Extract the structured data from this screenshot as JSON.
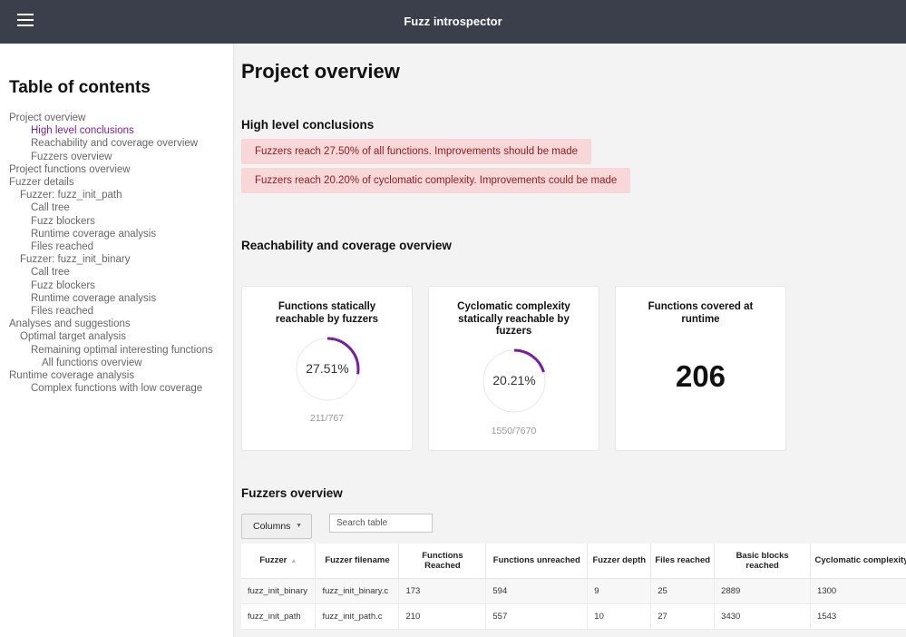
{
  "header": {
    "title": "Fuzz introspector",
    "menu_icon": "hamburger-menu-icon"
  },
  "sidebar": {
    "title": "Table of contents",
    "items": [
      {
        "label": "Project overview",
        "level": 1,
        "active": false
      },
      {
        "label": "High level conclusions",
        "level": 3,
        "active": true
      },
      {
        "label": "Reachability and coverage overview",
        "level": 3,
        "active": false
      },
      {
        "label": "Fuzzers overview",
        "level": 3,
        "active": false
      },
      {
        "label": "Project functions overview",
        "level": 1,
        "active": false
      },
      {
        "label": "Fuzzer details",
        "level": 1,
        "active": false
      },
      {
        "label": "Fuzzer: fuzz_init_path",
        "level": 2,
        "active": false
      },
      {
        "label": "Call tree",
        "level": 3,
        "active": false
      },
      {
        "label": "Fuzz blockers",
        "level": 3,
        "active": false
      },
      {
        "label": "Runtime coverage analysis",
        "level": 3,
        "active": false
      },
      {
        "label": "Files reached",
        "level": 3,
        "active": false
      },
      {
        "label": "Fuzzer: fuzz_init_binary",
        "level": 2,
        "active": false
      },
      {
        "label": "Call tree",
        "level": 3,
        "active": false
      },
      {
        "label": "Fuzz blockers",
        "level": 3,
        "active": false
      },
      {
        "label": "Runtime coverage analysis",
        "level": 3,
        "active": false
      },
      {
        "label": "Files reached",
        "level": 3,
        "active": false
      },
      {
        "label": "Analyses and suggestions",
        "level": 1,
        "active": false
      },
      {
        "label": "Optimal target analysis",
        "level": 2,
        "active": false
      },
      {
        "label": "Remaining optimal interesting functions",
        "level": 3,
        "active": false
      },
      {
        "label": "All functions overview",
        "level": 4,
        "active": false
      },
      {
        "label": "Runtime coverage analysis",
        "level": 1,
        "active": false
      },
      {
        "label": "Complex functions with low coverage",
        "level": 3,
        "active": false
      }
    ]
  },
  "main": {
    "title": "Project overview",
    "conclusions": {
      "title": "High level conclusions",
      "alerts": [
        "Fuzzers reach 27.50% of all functions. Improvements should be made",
        "Fuzzers reach 20.20% of cyclomatic complexity. Improvements could be made"
      ]
    },
    "reachability": {
      "title": "Reachability and coverage overview",
      "cards": [
        {
          "title": "Functions statically reachable by fuzzers",
          "value": "27.51%",
          "fraction": 0.2751,
          "sub": "211/767"
        },
        {
          "title": "Cyclomatic complexity statically reachable by fuzzers",
          "value": "20.21%",
          "fraction": 0.2021,
          "sub": "1550/7670"
        },
        {
          "title": "Functions covered at runtime",
          "value": "206"
        }
      ]
    },
    "fuzzers": {
      "title": "Fuzzers overview",
      "columns_button": "Columns",
      "search_placeholder": "Search table",
      "headers": [
        "Fuzzer",
        "Fuzzer filename",
        "Functions Reached",
        "Functions unreached",
        "Fuzzer depth",
        "Files reached",
        "Basic blocks reached",
        "Cyclomatic complexity"
      ],
      "rows": [
        [
          "fuzz_init_binary",
          "fuzz_init_binary.c",
          "173",
          "594",
          "9",
          "25",
          "2889",
          "1300"
        ],
        [
          "fuzz_init_path",
          "fuzz_init_path.c",
          "210",
          "557",
          "10",
          "27",
          "3430",
          "1543"
        ]
      ]
    }
  },
  "colors": {
    "topbar": "#3a3f4b",
    "accent": "#7a1ea1",
    "alert_bg": "#f8d7d9",
    "alert_text": "#8a1f24"
  }
}
